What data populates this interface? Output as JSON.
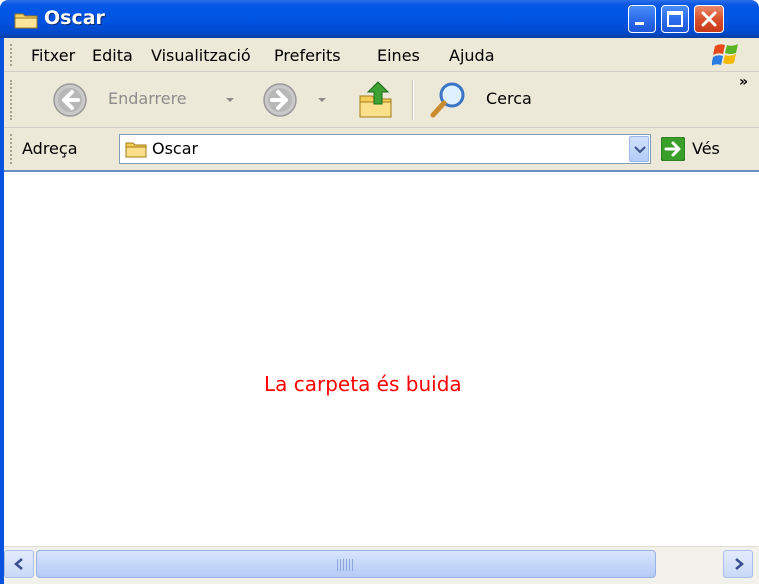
{
  "window": {
    "title": "Oscar",
    "controls": {
      "minimize_icon": "minimize-icon",
      "maximize_icon": "maximize-icon",
      "close_icon": "close-icon"
    }
  },
  "menubar": {
    "items": [
      {
        "label": "Fitxer"
      },
      {
        "label": "Edita"
      },
      {
        "label": "Visualització"
      },
      {
        "label": "Preferits"
      },
      {
        "label": "Eines"
      },
      {
        "label": "Ajuda"
      }
    ]
  },
  "toolbar": {
    "back_label": "Endarrere",
    "search_label": "Cerca",
    "more_glyph": "»"
  },
  "address_bar": {
    "label": "Adreça",
    "value": "Oscar",
    "go_label": "Vés"
  },
  "content": {
    "empty_message": "La carpeta és buida"
  },
  "colors": {
    "title_bar": "#0054e3",
    "chrome": "#ece9d8",
    "empty_message": "#ff0000"
  }
}
